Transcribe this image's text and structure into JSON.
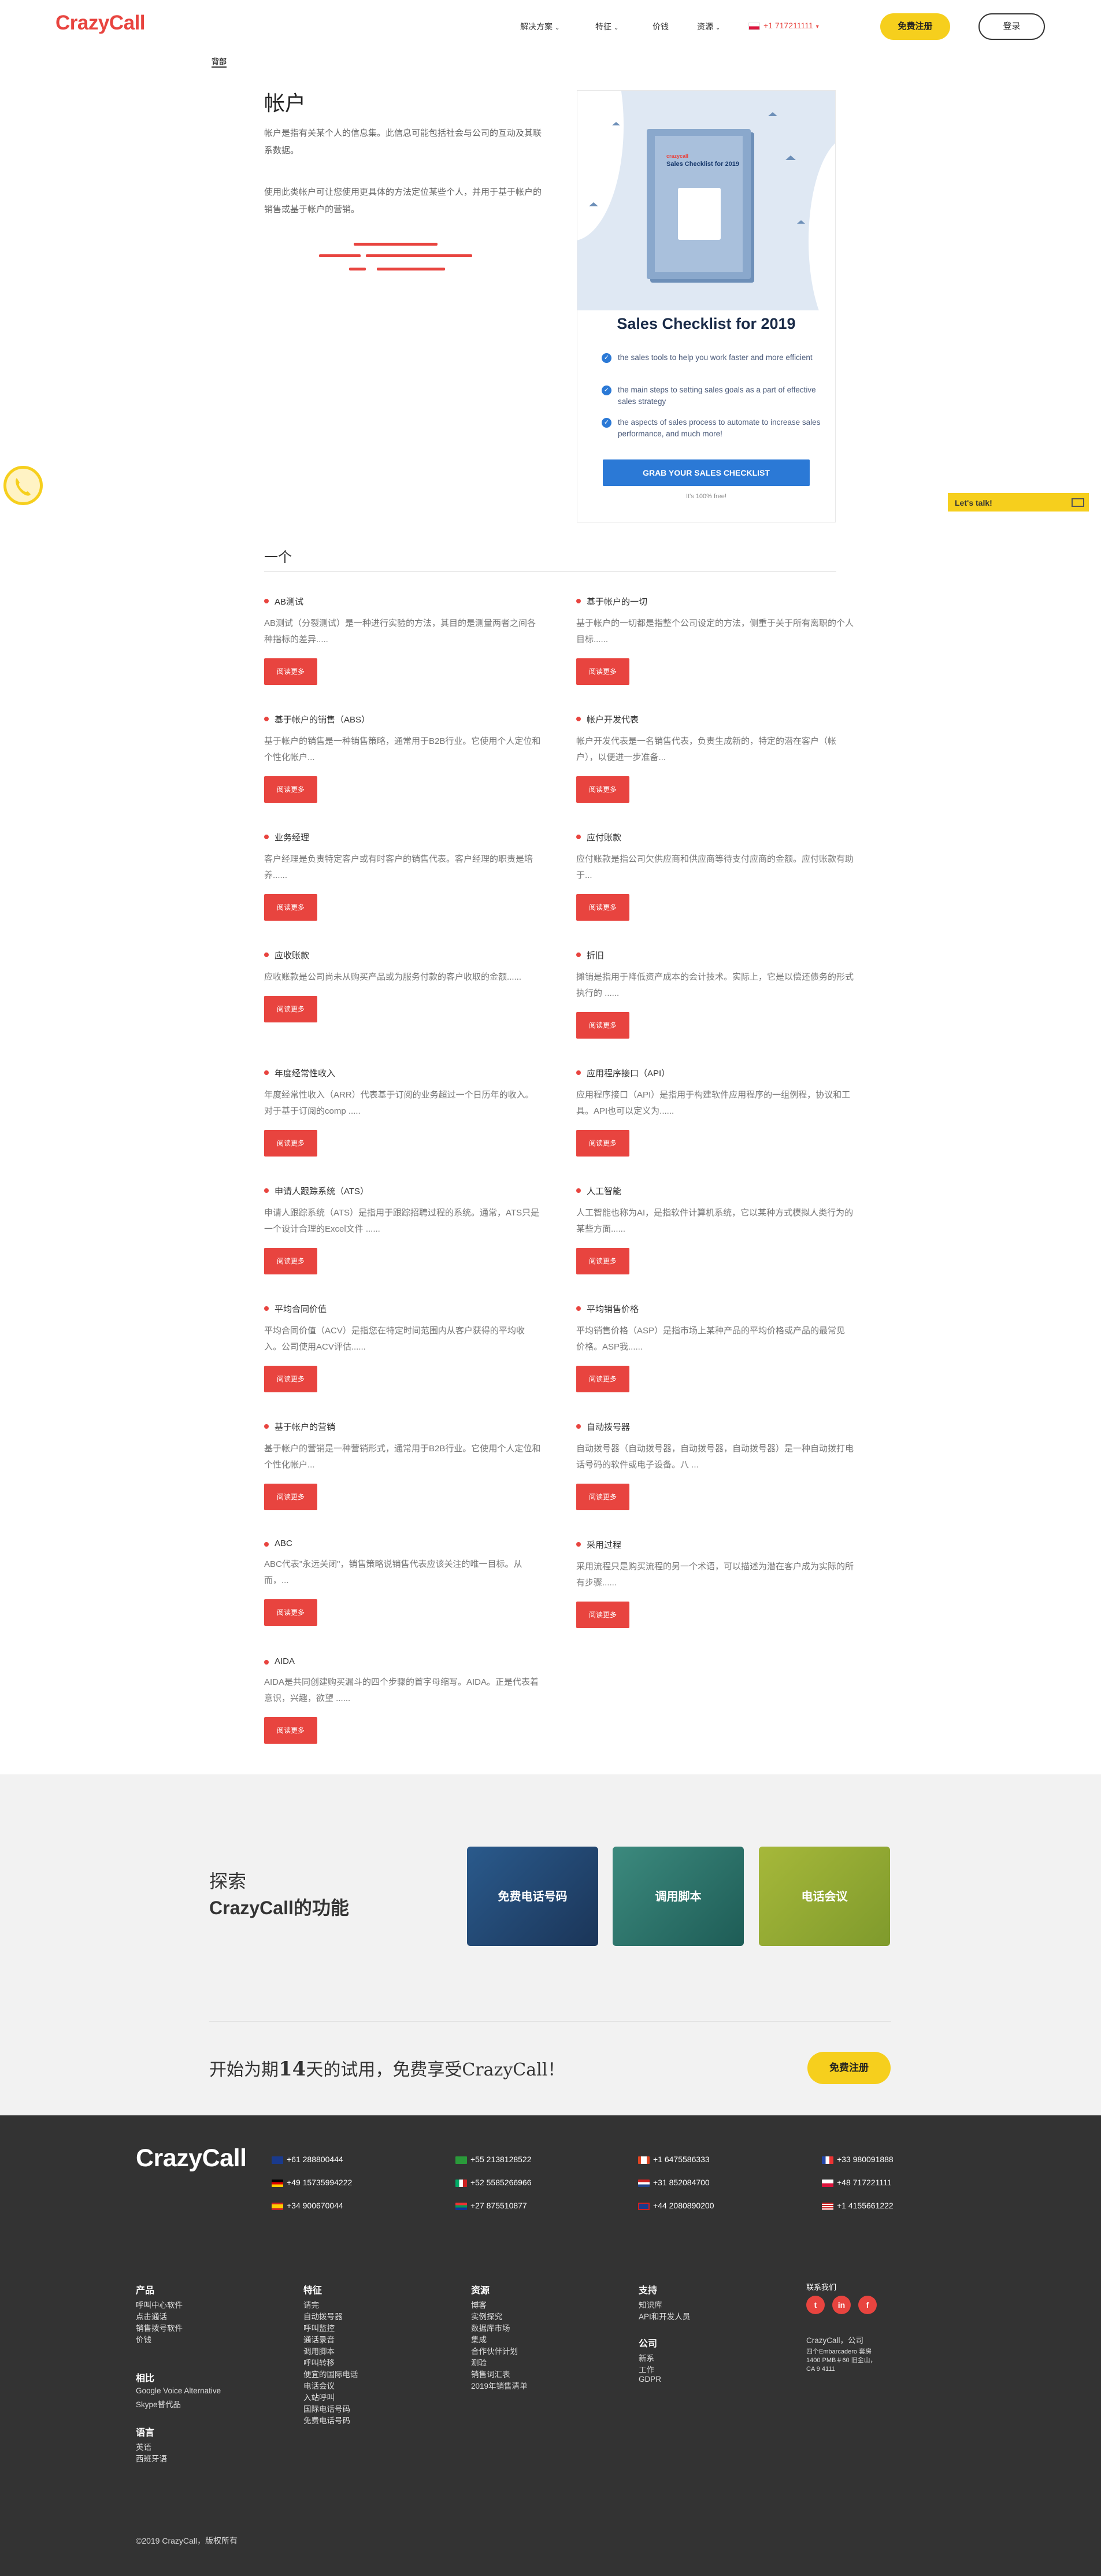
{
  "header": {
    "logo": "CrazyCall",
    "nav": [
      "解决方案",
      "特征",
      "价钱",
      "资源"
    ],
    "phone": "+1 717211111",
    "signup": "免费注册",
    "login": "登录"
  },
  "back_link": "背部",
  "intro": {
    "title": "帐户",
    "p1": "帐户是指有关某个人的信息集。此信息可能包括社会与公司的互动及其联系数据。",
    "p2": "使用此类帐户可让您使用更具体的方法定位某些个人，并用于基于帐户的销售或基于帐户的营销。"
  },
  "promo": {
    "book_brand": "crazycall",
    "book_title": "Sales Checklist for 2019",
    "title": "Sales Checklist for 2019",
    "bullets": [
      "the sales tools to help you work faster and more efficient",
      "the main steps to setting sales goals as a part of effective sales strategy",
      "the aspects of sales process to automate to increase sales performance, and much more!"
    ],
    "button": "GRAB YOUR SALES CHECKLIST",
    "note": "It's 100% free!"
  },
  "lets_talk": "Let's talk!",
  "section_title": "一个",
  "read_more": "阅读更多",
  "entries": [
    {
      "title": "AB测试",
      "desc": "AB测试（分裂测试）是一种进行实验的方法，其目的是测量两者之间各种指标的差异....."
    },
    {
      "title": "基于帐户的一切",
      "desc": "基于帐户的一切都是指整个公司设定的方法，侧重于关于所有离职的个人目标......"
    },
    {
      "title": "基于帐户的销售（ABS）",
      "desc": "基于帐户的销售是一种销售策略，通常用于B2B行业。它使用个人定位和个性化帐户..."
    },
    {
      "title": "帐户开发代表",
      "desc": "帐户开发代表是一名销售代表，负责生成新的，特定的潜在客户（帐户），以便进一步准备..."
    },
    {
      "title": "业务经理",
      "desc": "客户经理是负责特定客户或有时客户的销售代表。客户经理的职责是培养......"
    },
    {
      "title": "应付账款",
      "desc": "应付账款是指公司欠供应商和供应商等待支付应商的金额。应付账款有助于..."
    },
    {
      "title": "应收账款",
      "desc": "应收账款是公司尚未从购买产品或为服务付款的客户收取的金额......"
    },
    {
      "title": "折旧",
      "desc": "摊销是指用于降低资产成本的会计技术。实际上，它是以偿还债务的形式执行的 ......"
    },
    {
      "title": "年度经常性收入",
      "desc": "年度经常性收入（ARR）代表基于订阅的业务超过一个日历年的收入。对于基于订阅的comp ....."
    },
    {
      "title": "应用程序接口（API）",
      "desc": "应用程序接口（API）是指用于构建软件应用程序的一组例程，协议和工具。API也可以定义为......"
    },
    {
      "title": "申请人跟踪系统（ATS）",
      "desc": "申请人跟踪系统（ATS）是指用于跟踪招聘过程的系统。通常，ATS只是一个设计合理的Excel文件 ......"
    },
    {
      "title": "人工智能",
      "desc": "人工智能也称为AI，是指软件计算机系统，它以某种方式模拟人类行为的某些方面......"
    },
    {
      "title": "平均合同价值",
      "desc": "平均合同价值（ACV）是指您在特定时间范围内从客户获得的平均收入。公司使用ACV评估......"
    },
    {
      "title": "平均销售价格",
      "desc": "平均销售价格（ASP）是指市场上某种产品的平均价格或产品的最常见价格。ASP我......"
    },
    {
      "title": "基于帐户的营销",
      "desc": "基于帐户的营销是一种营销形式，通常用于B2B行业。它使用个人定位和个性化帐户..."
    },
    {
      "title": "自动拨号器",
      "desc": "自动拨号器（自动拨号器，自动拨号器，自动拨号器）是一种自动拨打电话号码的软件或电子设备。八 ..."
    },
    {
      "title": "ABC",
      "desc": "ABC代表\"永远关闭\"，销售策略说销售代表应该关注的唯一目标。从而，..."
    },
    {
      "title": "采用过程",
      "desc": "采用流程只是购买流程的另一个术语，可以描述为潜在客户成为实际的所有步骤......"
    },
    {
      "title": "AIDA",
      "desc": "AIDA是共同创建购买漏斗的四个步骤的首字母缩写。AIDA。正是代表着意识，兴趣，欲望 ......"
    }
  ],
  "explore": {
    "line1": "探索",
    "line2": "CrazyCall的功能",
    "tiles": [
      "免费电话号码",
      "调用脚本",
      "电话会议"
    ]
  },
  "trial": {
    "pre": "开始为期",
    "days": "14",
    "post": "天的试用，免费享受CrazyCall！",
    "button": "免费注册"
  },
  "footer": {
    "logo": "CrazyCall",
    "phones": [
      "+61 288800444",
      "+55 2138128522",
      "+1 6475586333",
      "+33 980091888",
      "+49 15735994222",
      "+52 5585266966",
      "+31 852084700",
      "+48 717221111",
      "+34 900670044",
      "+27 875510877",
      "+44 2080890200",
      "+1 4155661222"
    ],
    "cols": {
      "product": {
        "title": "产品",
        "links": [
          "呼叫中心软件",
          "点击通话",
          "销售拨号软件",
          "价钱"
        ]
      },
      "compare": {
        "title": "相比",
        "links": [
          "Google Voice Alternative",
          "Skype替代品"
        ]
      },
      "lang": {
        "title": "语言",
        "links": [
          "英语",
          "西班牙语"
        ]
      },
      "features": {
        "title": "特征",
        "links": [
          "请完",
          "自动拨号器",
          "呼叫监控",
          "通话录音",
          "调用脚本",
          "呼叫转移",
          "便宜的国际电话",
          "电话会议",
          "入站呼叫",
          "国际电话号码",
          "免费电话号码"
        ]
      },
      "resources": {
        "title": "资源",
        "links": [
          "博客",
          "实例探究",
          "数据库市场",
          "集成",
          "合作伙伴计划",
          "测验",
          "销售词汇表",
          "2019年销售清单"
        ]
      },
      "support": {
        "title": "支持",
        "links": [
          "知识库",
          "API和开发人员"
        ]
      },
      "company": {
        "title": "公司",
        "links": [
          "新系",
          "工作",
          "GDPR"
        ]
      },
      "contact": {
        "title": "联系我们",
        "company_name": "CrazyCall，公司",
        "address": "四个Embarcadero 套房1400 PMB＃60 旧金山，CA 9 4111"
      }
    },
    "copyright": "©2019 CrazyCall，版权所有"
  }
}
